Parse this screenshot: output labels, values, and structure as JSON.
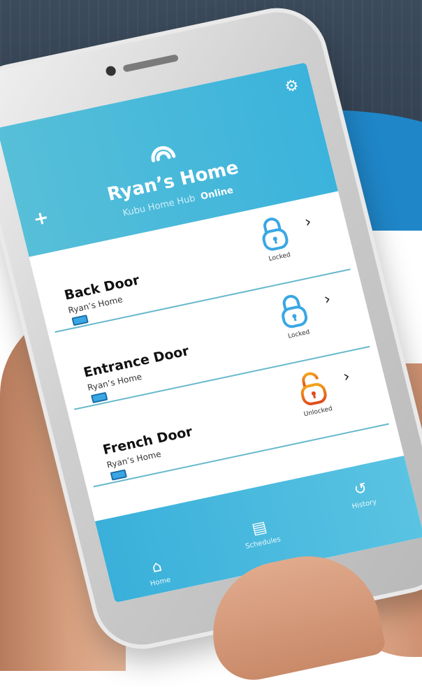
{
  "header": {
    "title": "Ryan’s Home",
    "hub_name": "Kubu Home Hub",
    "hub_status": "Online",
    "add_icon": "plus-icon",
    "settings_icon": "gear-icon",
    "hub_icon": "wifi-hub-icon"
  },
  "locks": [
    {
      "name": "Back Door",
      "home": "Ryan’s Home",
      "status": "Locked",
      "state_color": "#3aa7e4"
    },
    {
      "name": "Entrance Door",
      "home": "Ryan’s Home",
      "status": "Locked",
      "state_color": "#3aa7e4"
    },
    {
      "name": "French Door",
      "home": "Ryan’s Home",
      "status": "Unlocked",
      "state_color": "#e24a1b"
    }
  ],
  "tabs": {
    "home": "Home",
    "schedules": "Schedules",
    "history": "History"
  },
  "colors": {
    "accent": "#3bb3dc",
    "locked": "#3aa7e4",
    "unlocked": "#e24a1b"
  }
}
